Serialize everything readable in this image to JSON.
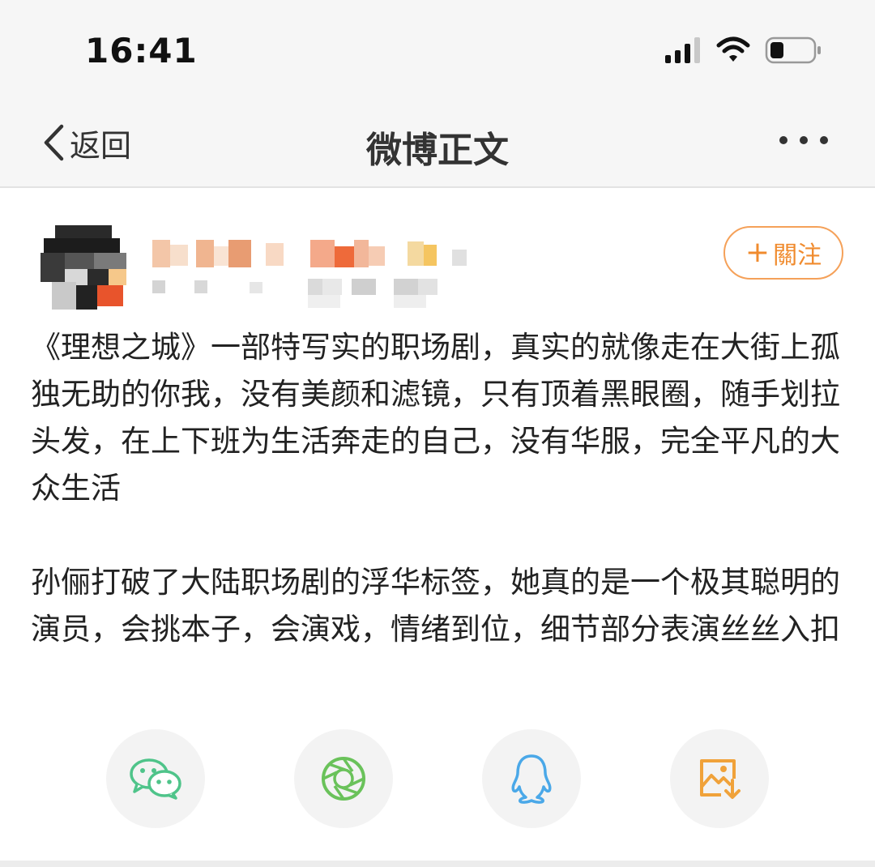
{
  "status_bar": {
    "time": "16:41",
    "icons": [
      "signal-icon",
      "wifi-icon",
      "battery-icon"
    ]
  },
  "nav": {
    "back_label": "返回",
    "title": "微博正文",
    "more_icon": "more-icon"
  },
  "post": {
    "follow_label": "關注",
    "paragraphs": [
      "《理想之城》一部特写实的职场剧，真实的就像走在大街上孤独无助的你我，没有美颜和滤镜，只有顶着黑眼圈，随手划拉头发，在上下班为生活奔走的自己，没有华服，完全平凡的大众生活",
      "孙俪打破了大陆职场剧的浮华标签，她真的是一个极其聪明的演员，会挑本子，会演戏，情绪到位，细节部分表演丝丝入扣"
    ]
  },
  "share": {
    "items": [
      {
        "icon": "wechat-icon",
        "color": "#4fc48a"
      },
      {
        "icon": "moments-icon",
        "color": "#6ac25a"
      },
      {
        "icon": "qq-icon",
        "color": "#4aa8e8"
      },
      {
        "icon": "save-image-icon",
        "color": "#f0a23a"
      }
    ]
  },
  "colors": {
    "accent": "#f08b2e",
    "background": "#f5f5f5",
    "card": "#ffffff"
  }
}
